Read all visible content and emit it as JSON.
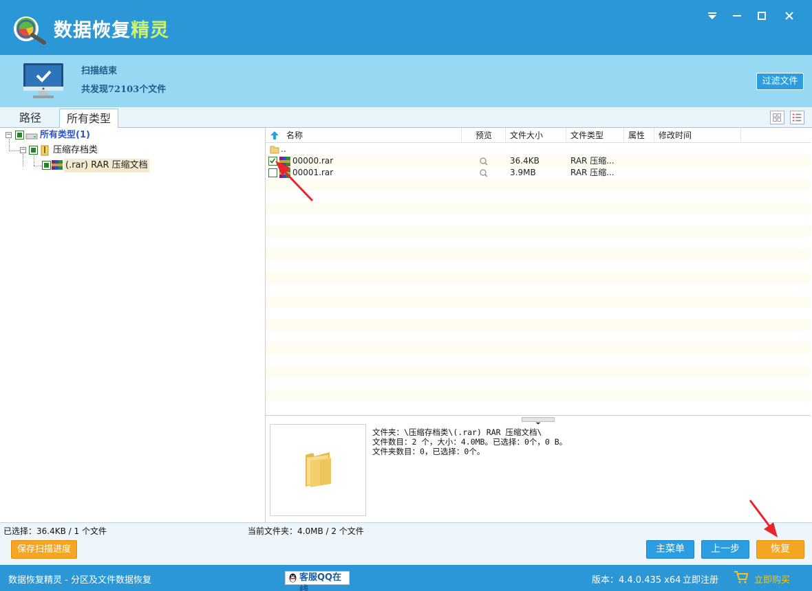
{
  "app": {
    "title_main": "数据恢复",
    "title_accent": "精灵"
  },
  "banner": {
    "scan_title": "扫描结束",
    "scan_summary": "共发现72103个文件",
    "filter_button": "过滤文件"
  },
  "tabs": [
    {
      "label": "路径",
      "active": false
    },
    {
      "label": "所有类型",
      "active": true
    }
  ],
  "tree": {
    "root_label": "所有类型(1)",
    "child_label": "压缩存档类",
    "leaf_label": "(.rar) RAR 压缩文档"
  },
  "file_list": {
    "columns": [
      "名称",
      "预览",
      "文件大小",
      "文件类型",
      "属性",
      "修改时间"
    ],
    "parent_dir": "..",
    "rows": [
      {
        "name": "00000.rar",
        "size": "36.4KB",
        "type": "RAR 压缩...",
        "checked": true
      },
      {
        "name": "00001.rar",
        "size": "3.9MB",
        "type": "RAR 压缩...",
        "checked": false
      }
    ]
  },
  "preview": {
    "line1": "文件夹：\\压缩存档类\\(.rar) RAR 压缩文档\\",
    "line2": "文件数目：2 个，大小：4.0MB。已选择：0个，0 B。",
    "line3": "文件夹数目：0，已选择：0个。"
  },
  "status": {
    "selected": "已选择：36.4KB / 1 个文件",
    "current_folder": "当前文件夹：4.0MB / 2 个文件"
  },
  "buttons": {
    "save_progress": "保存扫描进度",
    "main_menu": "主菜单",
    "previous": "上一步",
    "recover": "恢复"
  },
  "footer": {
    "left_text": "数据恢复精灵 - 分区及文件数据恢复",
    "qq_button": "客服QQ在线",
    "version": "版本：4.4.0.435 x64",
    "register": "立即注册",
    "buy": "立即购买"
  },
  "colors": {
    "titlebar": "#2b97d6",
    "banner": "#97d8f2",
    "accent_orange": "#f5a524",
    "accent_green": "#c8f26a"
  },
  "icons": [
    "app-logo-icon",
    "minimize-icon",
    "maximize-icon",
    "close-icon",
    "menu-dropdown-icon",
    "monitor-check-icon",
    "grid-view-icon",
    "list-view-icon",
    "folder-icon",
    "rar-file-icon",
    "magnifier-icon",
    "cart-icon",
    "qq-penguin-icon",
    "up-arrow-icon"
  ]
}
